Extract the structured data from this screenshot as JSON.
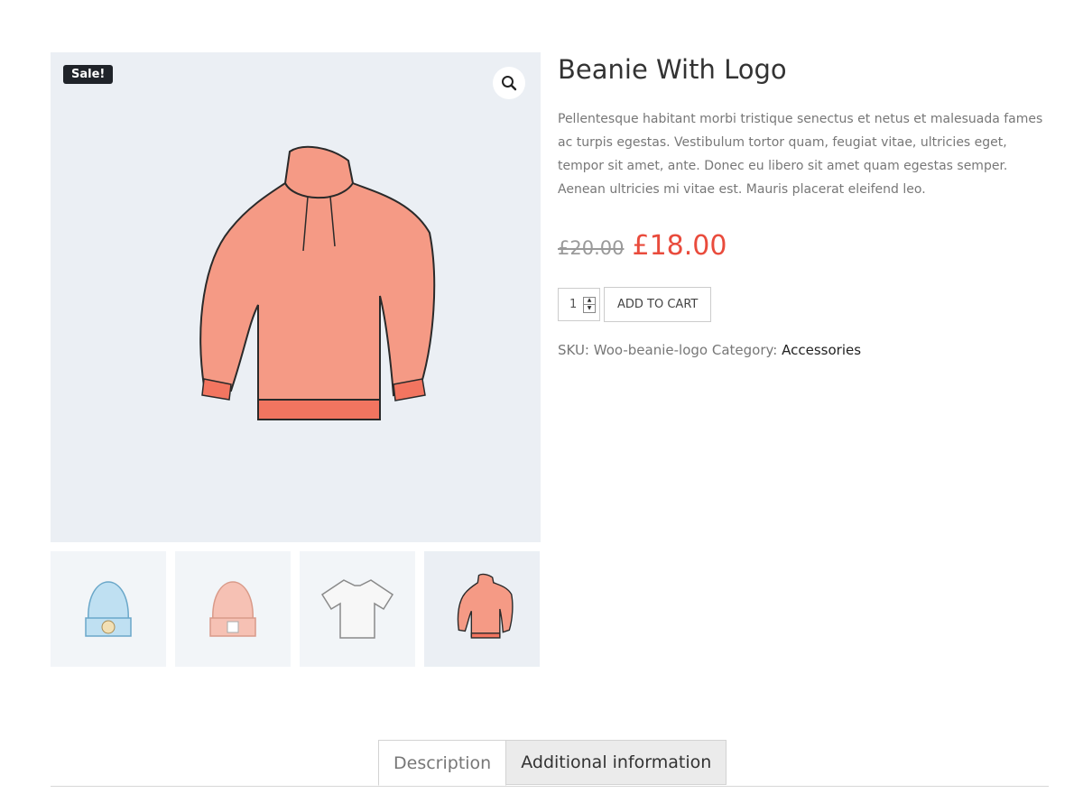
{
  "gallery": {
    "sale_badge": "Sale!",
    "zoom_icon": "magnifier-icon",
    "thumbnails": [
      {
        "name": "blue-beanie",
        "active": false
      },
      {
        "name": "pink-beanie",
        "active": false
      },
      {
        "name": "white-tshirt",
        "active": false
      },
      {
        "name": "pink-hoodie",
        "active": true
      }
    ]
  },
  "product": {
    "title": "Beanie With Logo",
    "description": "Pellentesque habitant morbi tristique senectus et netus et malesuada fames ac turpis egestas. Vestibulum tortor quam, feugiat vitae, ultricies eget, tempor sit amet, ante. Donec eu libero sit amet quam egestas semper. Aenean ultricies mi vitae est. Mauris placerat eleifend leo.",
    "old_price": "£20.00",
    "new_price": "£18.00",
    "quantity": "1",
    "add_to_cart_label": "ADD TO CART",
    "sku_label": "SKU:",
    "sku_value": "Woo-beanie-logo",
    "category_label": "Category:",
    "category_value": "Accessories"
  },
  "tabs": {
    "description": "Description",
    "additional_information": "Additional information"
  },
  "colors": {
    "sale_price": "#e94b3c",
    "badge_bg": "#1f2329",
    "image_bg": "#ebeff4"
  }
}
